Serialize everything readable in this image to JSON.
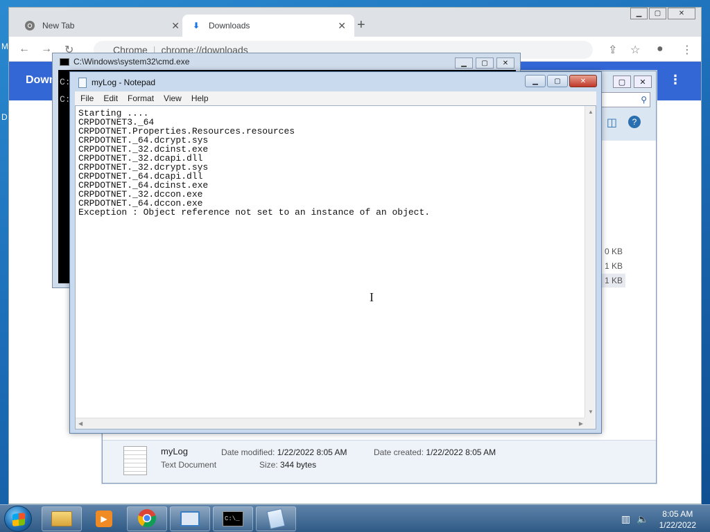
{
  "desktop": {
    "glyph_m": "M",
    "glyph_d": "D"
  },
  "chrome": {
    "tabs": [
      {
        "label": "New Tab",
        "icon": "chrome-icon"
      },
      {
        "label": "Downloads",
        "icon": "download-icon"
      }
    ],
    "address_prefix": "Chrome",
    "address": "chrome://downloads",
    "page_title": "Down"
  },
  "explorer": {
    "sizes": [
      "0 KB",
      "1 KB",
      "1 KB"
    ],
    "details": {
      "name": "myLog",
      "type": "Text Document",
      "date_modified_label": "Date modified:",
      "date_modified": "1/22/2022 8:05 AM",
      "date_created_label": "Date created:",
      "date_created": "1/22/2022 8:05 AM",
      "size_label": "Size:",
      "size": "344 bytes"
    }
  },
  "cmd": {
    "title": "C:\\Windows\\system32\\cmd.exe",
    "lines": [
      "C:",
      "C:"
    ]
  },
  "notepad": {
    "title": "myLog - Notepad",
    "menu": [
      "File",
      "Edit",
      "Format",
      "View",
      "Help"
    ],
    "content": "Starting ....\nCRPDOTNET3._64\nCRPDOTNET.Properties.Resources.resources\nCRPDOTNET._64.dcrypt.sys\nCRPDOTNET._32.dcinst.exe\nCRPDOTNET._32.dcapi.dll\nCRPDOTNET._32.dcrypt.sys\nCRPDOTNET._64.dcapi.dll\nCRPDOTNET._64.dcinst.exe\nCRPDOTNET._32.dccon.exe\nCRPDOTNET._64.dccon.exe\nException : Object reference not set to an instance of an object."
  },
  "taskbar": {
    "time": "8:05 AM",
    "date": "1/22/2022",
    "apps": [
      "explorer-icon",
      "media-player-icon",
      "chrome-icon",
      "control-panel-icon",
      "cmd-icon",
      "notepad-icon"
    ]
  },
  "colors": {
    "chrome_header": "#3367d6",
    "notepad_close": "#c0392b"
  }
}
